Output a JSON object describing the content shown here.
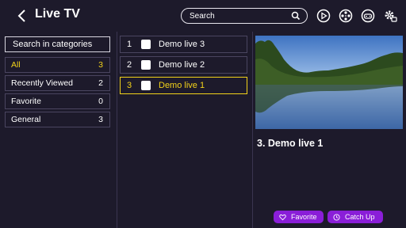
{
  "header": {
    "title": "Live TV",
    "search_placeholder": "Search",
    "icons": [
      "back-arrow-icon",
      "search-icon",
      "play-circle-icon",
      "film-reel-icon",
      "gamepad-icon",
      "settings-gear-icon"
    ]
  },
  "categories": {
    "search_label": "Search in categories",
    "items": [
      {
        "label": "All",
        "count": "3"
      },
      {
        "label": "Recently Viewed",
        "count": "2"
      },
      {
        "label": "Favorite",
        "count": "0"
      },
      {
        "label": "General",
        "count": "3"
      }
    ]
  },
  "channels": {
    "items": [
      {
        "number": "1",
        "name": "Demo live 3"
      },
      {
        "number": "2",
        "name": "Demo live 2"
      },
      {
        "number": "3",
        "name": "Demo live 1"
      }
    ]
  },
  "preview": {
    "title": "3.  Demo live 1",
    "favorite_label": "Favorite",
    "catchup_label": "Catch Up"
  },
  "colors": {
    "background": "#1d1a2b",
    "accent": "#f2d21a",
    "button": "#8a1ed8"
  }
}
